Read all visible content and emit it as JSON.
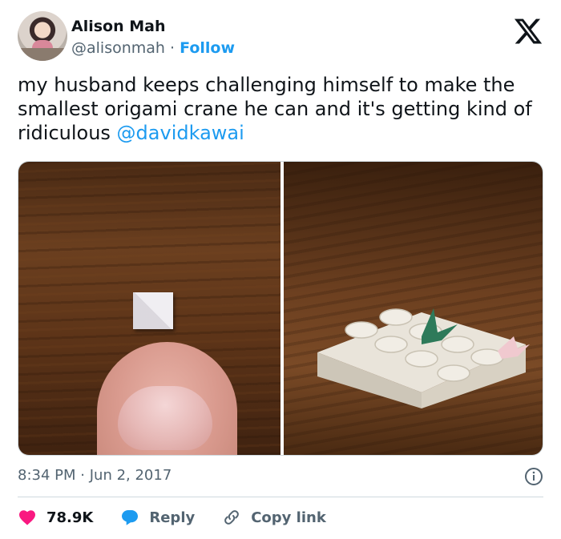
{
  "author": {
    "name": "Alison Mah",
    "handle": "@alisonmah",
    "separator": "·",
    "follow_label": "Follow"
  },
  "tweet": {
    "text": "my husband keeps challenging himself to make the smallest origami crane he can and it's getting kind of ridiculous ",
    "mention": "@davidkawai"
  },
  "media": {
    "images": [
      "thumb-and-paper-crane-photo",
      "lego-brick-with-cranes-photo"
    ]
  },
  "meta": {
    "time": "8:34 PM",
    "dot": "·",
    "date": "Jun 2, 2017"
  },
  "actions": {
    "likes": "78.9K",
    "reply_label": "Reply",
    "copy_link_label": "Copy link"
  },
  "colors": {
    "accent": "#1d9bf0",
    "like": "#f91880",
    "muted": "#536471"
  },
  "icons": [
    "x-logo-icon",
    "info-icon",
    "heart-icon",
    "reply-icon",
    "link-icon"
  ]
}
